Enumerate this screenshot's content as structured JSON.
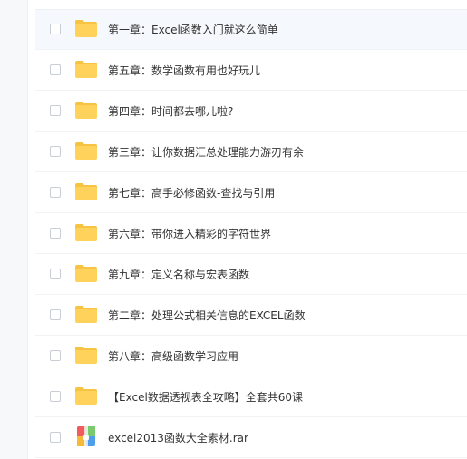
{
  "files": [
    {
      "name": "第一章：Excel函数入门就这么简单",
      "type": "folder",
      "icon": "folder-icon",
      "selected": true
    },
    {
      "name": "第五章：数学函数有用也好玩儿",
      "type": "folder",
      "icon": "folder-icon"
    },
    {
      "name": "第四章：时间都去哪儿啦?",
      "type": "folder",
      "icon": "folder-icon"
    },
    {
      "name": "第三章：让你数据汇总处理能力游刃有余",
      "type": "folder",
      "icon": "folder-icon"
    },
    {
      "name": "第七章：高手必修函数-查找与引用",
      "type": "folder",
      "icon": "folder-icon"
    },
    {
      "name": "第六章：带你进入精彩的字符世界",
      "type": "folder",
      "icon": "folder-icon"
    },
    {
      "name": "第九章：定义名称与宏表函数",
      "type": "folder",
      "icon": "folder-icon"
    },
    {
      "name": "第二章：处理公式相关信息的EXCEL函数",
      "type": "folder",
      "icon": "folder-icon"
    },
    {
      "name": "第八章：高级函数学习应用",
      "type": "folder",
      "icon": "folder-icon"
    },
    {
      "name": "【Excel数据透视表全攻略】全套共60课",
      "type": "folder",
      "icon": "folder-icon"
    },
    {
      "name": "excel2013函数大全素材.rar",
      "type": "archive",
      "icon": "archive-icon"
    }
  ],
  "colors": {
    "folder": "#FFD25C",
    "folder_tab": "#F6C343",
    "selected_row": "#f5f8fc"
  }
}
